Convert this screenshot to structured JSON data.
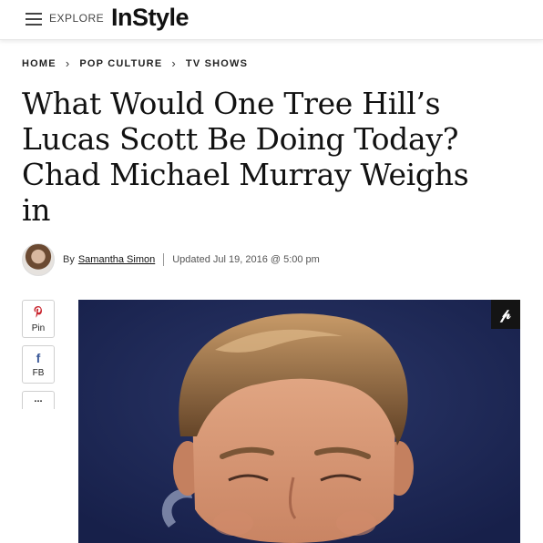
{
  "header": {
    "menu_icon": "hamburger-menu-icon",
    "explore_label": "EXPLORE",
    "logo_text": "InStyle"
  },
  "breadcrumb": {
    "items": [
      "HOME",
      "POP CULTURE",
      "TV SHOWS"
    ],
    "separator_icon": "chevron-right-icon"
  },
  "article": {
    "headline_lines": [
      "What Would One Tree Hill’s",
      "Lucas Scott Be Doing Today?",
      "Chad Michael Murray Weighs",
      "in"
    ],
    "byline_prefix": "By",
    "author": "Samantha Simon",
    "updated": "Updated Jul 19, 2016 @ 5:00 pm"
  },
  "share": {
    "pinterest_label": "Pin",
    "facebook_label": "FB",
    "more_label": "..."
  },
  "hero": {
    "pin_icon": "pinterest-icon",
    "colors": {
      "background": "#1f2a52",
      "hair": "#6e4e2e",
      "skin": "#d99a78"
    }
  }
}
